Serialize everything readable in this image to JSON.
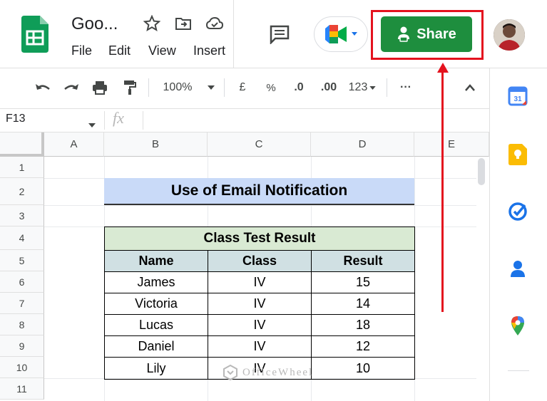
{
  "app": {
    "title": "Goo...",
    "menu": [
      "File",
      "Edit",
      "View",
      "Insert"
    ]
  },
  "header": {
    "share_label": "Share",
    "icons": [
      "star-icon",
      "move-to-folder-icon",
      "cloud-status-icon",
      "comments-icon",
      "google-meet-icon",
      "avatar"
    ]
  },
  "toolbar": {
    "zoom": "100%",
    "currency": "£",
    "percent": "%",
    "decrease_decimal": ".0",
    "increase_decimal": ".00",
    "number_format": "123",
    "more": "···"
  },
  "formula_bar": {
    "cell_ref": "F13",
    "fx": "fx"
  },
  "grid": {
    "columns": [
      "A",
      "B",
      "C",
      "D",
      "E"
    ],
    "rows": [
      "1",
      "2",
      "3",
      "4",
      "5",
      "6",
      "7",
      "8",
      "9",
      "10",
      "11"
    ]
  },
  "sheet": {
    "heading": "Use of Email Notification",
    "table_caption": "Class Test Result",
    "table_headers": [
      "Name",
      "Class",
      "Result"
    ],
    "table_rows": [
      [
        "James",
        "IV",
        "15"
      ],
      [
        "Victoria",
        "IV",
        "14"
      ],
      [
        "Lucas",
        "IV",
        "18"
      ],
      [
        "Daniel",
        "IV",
        "12"
      ],
      [
        "Lily",
        "IV",
        "10"
      ]
    ]
  },
  "side_panel": [
    "calendar-icon",
    "keep-icon",
    "tasks-icon",
    "contacts-icon",
    "maps-icon"
  ],
  "watermark": "OfficeWheel",
  "colors": {
    "share_green": "#1e8e3e",
    "highlight_red": "#e4121e",
    "heading_blue": "#c9daf8",
    "caption_green": "#d9ead3",
    "header_teal": "#d0e0e3"
  }
}
